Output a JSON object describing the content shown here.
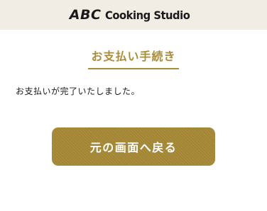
{
  "header": {
    "logo_brand": "ABC",
    "logo_text": "Cooking Studio"
  },
  "main": {
    "title": "お支払い手続き",
    "message": "お支払いが完了いたしました。",
    "back_button_label": "元の画面へ戻る"
  },
  "colors": {
    "header_bg": "#f1ede4",
    "accent_gold": "#a98c3c",
    "button_bg": "#a68936",
    "text_dark": "#1a1a1a"
  }
}
